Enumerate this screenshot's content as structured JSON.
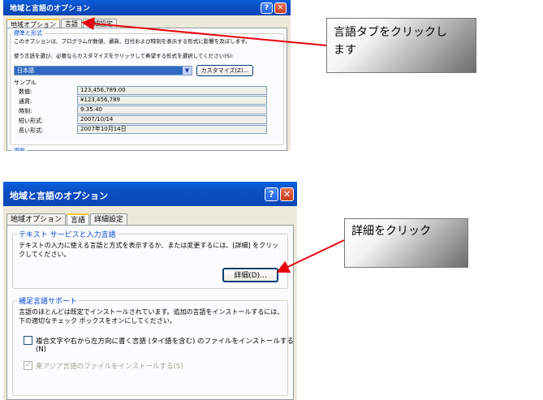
{
  "window1": {
    "title": "地域と言語のオプション",
    "help_glyph": "?",
    "close_glyph": "✕",
    "tabs": [
      "地域オプション",
      "言語",
      "詳細設定"
    ],
    "group_title": "標準と形式",
    "desc": "このオプションは、プログラムが数値、通貨、日付および時刻を表示する形式に影響を及ぼします。",
    "instruction": "使う言語を選び、必要ならカスタマイズをクリックして希望する形式を選択してください(S):",
    "locale_value": "日本語",
    "customize_button": "カスタマイズ(Z)...",
    "sample_title": "サンプル",
    "samples": [
      {
        "label": "数値:",
        "value": "123,456,789.00"
      },
      {
        "label": "通貨:",
        "value": "¥123,456,789"
      },
      {
        "label": "時刻:",
        "value": "9:35:40"
      },
      {
        "label": "短い形式:",
        "value": "2007/10/14"
      },
      {
        "label": "長い形式:",
        "value": "2007年10月14日"
      }
    ],
    "bottom_cut": "場所"
  },
  "window2": {
    "title": "地域と言語のオプション",
    "help_glyph": "?",
    "close_glyph": "✕",
    "tabs": [
      "地域オプション",
      "言語",
      "詳細設定"
    ],
    "group1_title": "テキスト サービスと入力言語",
    "group1_text": [
      "テキストの入力に使える言語と方式を表示するか、または変更するには、[詳細] をクリッ",
      "クしてください。"
    ],
    "details_button": "詳細(D)...",
    "group2_title": "補足言語サポート",
    "group2_text": [
      "言語のほとんどは既定でインストールされています。追加の言語をインストールするには、",
      "下の適切なチェック ボックスをオンにしてください。"
    ],
    "check1_label": "複合文字や右から左方向に書く言語 (タイ語を含む) のファイルをインストールする",
    "check1_label2": "(N)",
    "check2_label": "東アジア言語のファイルをインストールする(S)"
  },
  "callouts": {
    "top": [
      "言語タブをクリックし",
      "ます"
    ],
    "bottom": "詳細をクリック"
  },
  "colors": {
    "arrow": "#E8000D",
    "titlebar": "#0A5FDC",
    "group_title": "#0046D5"
  }
}
